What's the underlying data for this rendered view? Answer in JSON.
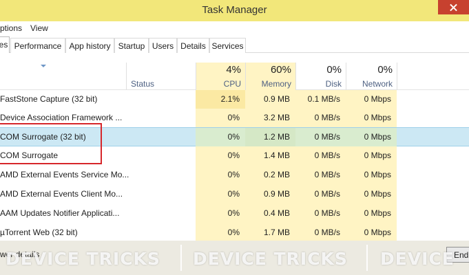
{
  "window": {
    "title": "Task Manager"
  },
  "menu": [
    "ptions",
    "View"
  ],
  "tabs": [
    "es",
    "Performance",
    "App history",
    "Startup",
    "Users",
    "Details",
    "Services"
  ],
  "columns": {
    "status": "Status",
    "cpu": {
      "pct": "4%",
      "label": "CPU"
    },
    "memory": {
      "pct": "60%",
      "label": "Memory"
    },
    "disk": {
      "pct": "0%",
      "label": "Disk"
    },
    "network": {
      "pct": "0%",
      "label": "Network"
    }
  },
  "rows": [
    {
      "name": "FastStone Capture (32 bit)",
      "cpu": "2.1%",
      "memory": "0.9 MB",
      "disk": "0.1 MB/s",
      "network": "0 Mbps"
    },
    {
      "name": "Device Association Framework ...",
      "cpu": "0%",
      "memory": "3.2 MB",
      "disk": "0 MB/s",
      "network": "0 Mbps"
    },
    {
      "name": "COM Surrogate (32 bit)",
      "cpu": "0%",
      "memory": "1.2 MB",
      "disk": "0 MB/s",
      "network": "0 Mbps"
    },
    {
      "name": "COM Surrogate",
      "cpu": "0%",
      "memory": "1.4 MB",
      "disk": "0 MB/s",
      "network": "0 Mbps"
    },
    {
      "name": "AMD External Events Service Mo...",
      "cpu": "0%",
      "memory": "0.2 MB",
      "disk": "0 MB/s",
      "network": "0 Mbps"
    },
    {
      "name": "AMD External Events Client Mo...",
      "cpu": "0%",
      "memory": "0.9 MB",
      "disk": "0 MB/s",
      "network": "0 Mbps"
    },
    {
      "name": "AAM Updates Notifier Applicati...",
      "cpu": "0%",
      "memory": "0.4 MB",
      "disk": "0 MB/s",
      "network": "0 Mbps"
    },
    {
      "name": "µTorrent Web (32 bit)",
      "cpu": "0%",
      "memory": "1.7 MB",
      "disk": "0 MB/s",
      "network": "0 Mbps"
    }
  ],
  "footer": {
    "details": "wer details",
    "end_task": "End"
  },
  "watermark": [
    "DEVICE TRICKS",
    "DEVICE TRICKS",
    "DEVICE"
  ]
}
